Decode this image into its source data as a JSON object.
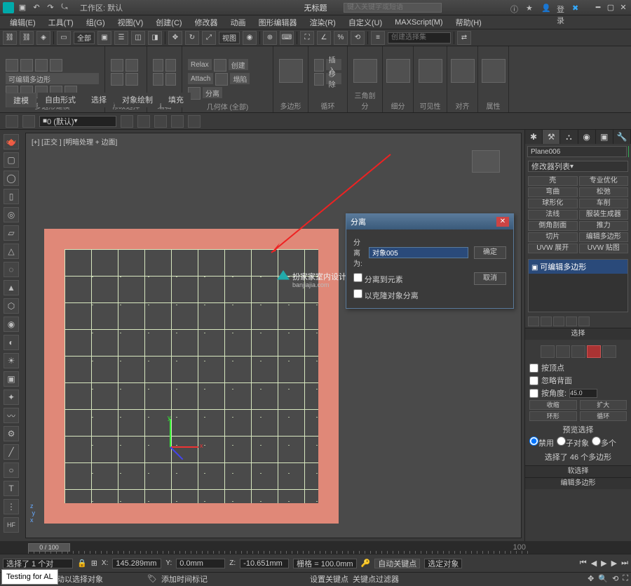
{
  "titlebar": {
    "workspace_label": "工作区: 默认",
    "title": "无标题",
    "search_placeholder": "键入关键字或短语",
    "login": "登录"
  },
  "menu": {
    "items": [
      "编辑(E)",
      "工具(T)",
      "组(G)",
      "视图(V)",
      "创建(C)",
      "修改器",
      "动画",
      "图形编辑器",
      "渲染(R)",
      "自定义(U)",
      "MAXScript(M)",
      "帮助(H)"
    ]
  },
  "maintool": {
    "all": "全部",
    "view": "视图",
    "set_placeholder": "创建选择集"
  },
  "ribbon": {
    "tabs": [
      "建模",
      "自由形式",
      "选择",
      "对象绘制",
      "填充"
    ],
    "panel1_title": "多边形建模",
    "panel1_label": "可编辑多边形",
    "panel2_title": "修改选择",
    "panel3_title": "编辑",
    "panel4_title": "几何体 (全部)",
    "relax": "Relax",
    "attach": "Attach",
    "detach": "分离",
    "create": "创建",
    "collapse": "塌陷",
    "poly_title": "多边形",
    "insert": "插入",
    "remove": "移除",
    "loop_title": "循环",
    "tri": "三角剖分",
    "sub": "细分",
    "vis": "可见性",
    "align": "对齐",
    "prop": "属性"
  },
  "layerbar": {
    "layer": "0 (默认)"
  },
  "viewport": {
    "label": "[+] [正交 ] [明暗处理 + 边面]"
  },
  "dialog": {
    "title": "分离",
    "label_as": "分离为:",
    "value": "对象005",
    "cb1": "分离到元素",
    "cb2": "以克隆对象分离",
    "ok": "确定",
    "cancel": "取消"
  },
  "watermark": {
    "text": "扮家家室内设计",
    "sub": "banjiajia.com"
  },
  "rightpanel": {
    "object_name": "Plane006",
    "modlist": "修改器列表",
    "buttons": [
      "壳",
      "专业优化",
      "弯曲",
      "松弛",
      "球形化",
      "车削",
      "法线",
      "服装生成器",
      "倒角剖面",
      "推力",
      "切片",
      "编辑多边形",
      "UVW 展开",
      "UVW 贴图"
    ],
    "stack_item": "可编辑多边形",
    "rollout_sel": "选择",
    "by_vertex": "按顶点",
    "ignore_bf": "忽略背面",
    "by_angle": "按角度:",
    "angle_val": "45.0",
    "shrink": "收缩",
    "grow": "扩大",
    "ring": "环形",
    "loop": "循环",
    "preview": "预览选择",
    "off": "禁用",
    "subobj": "子对象",
    "multi": "多个",
    "sel_status": "选择了 46 个多边形",
    "soft_sel": "软选择",
    "edit_poly": "编辑多边形"
  },
  "timeline": {
    "pos": "0 / 100",
    "end": "100"
  },
  "status": {
    "sel": "选择了 1 个对 ",
    "x": "145.289mm",
    "y": "0.0mm",
    "z": "-10.651mm",
    "grid": "栅格 = 100.0mm",
    "autokey": "自动关键点",
    "selected": "选定对象",
    "hint": "单击或单击并拖动以选择对象",
    "addtime": "添加时间标记",
    "setkey": "设置关键点",
    "keyfilter": "关键点过滤器"
  },
  "testing": "Testing for AL"
}
